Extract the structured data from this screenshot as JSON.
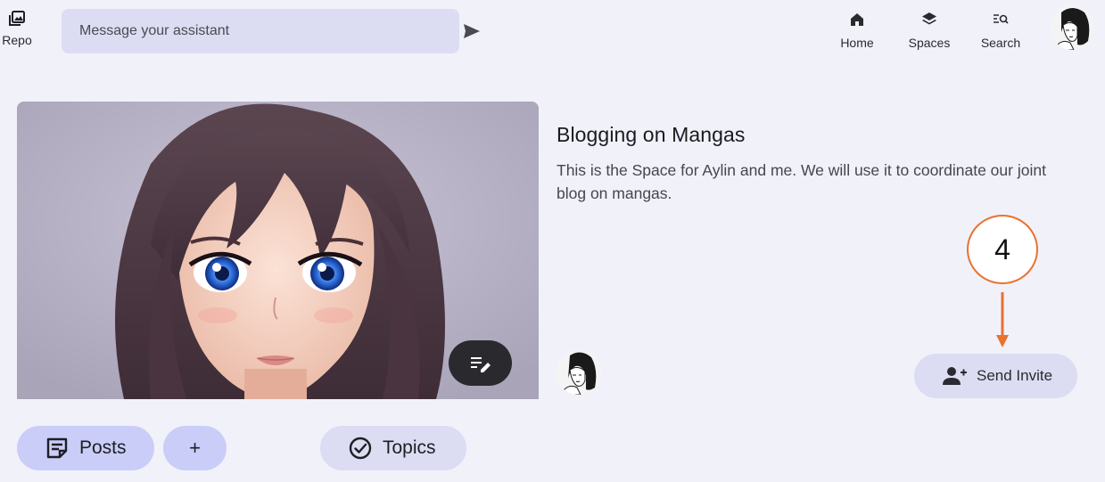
{
  "topbar": {
    "repo_label": "Repo",
    "message_placeholder": "Message your assistant",
    "nav": {
      "home": "Home",
      "spaces": "Spaces",
      "search": "Search"
    }
  },
  "space": {
    "title": "Blogging on Mangas",
    "description": "This is the Space for Aylin and me. We will use it to coordinate our joint blog on mangas."
  },
  "step_marker": {
    "number": "4",
    "color": "#e8722e"
  },
  "actions": {
    "send_invite": "Send Invite"
  },
  "tabs": {
    "posts": "Posts",
    "add": "+",
    "topics": "Topics"
  },
  "colors": {
    "background": "#f1f1fa",
    "pill": "#dcdcf2",
    "pill_active": "#c9cdf8",
    "accent": "#e8722e"
  }
}
